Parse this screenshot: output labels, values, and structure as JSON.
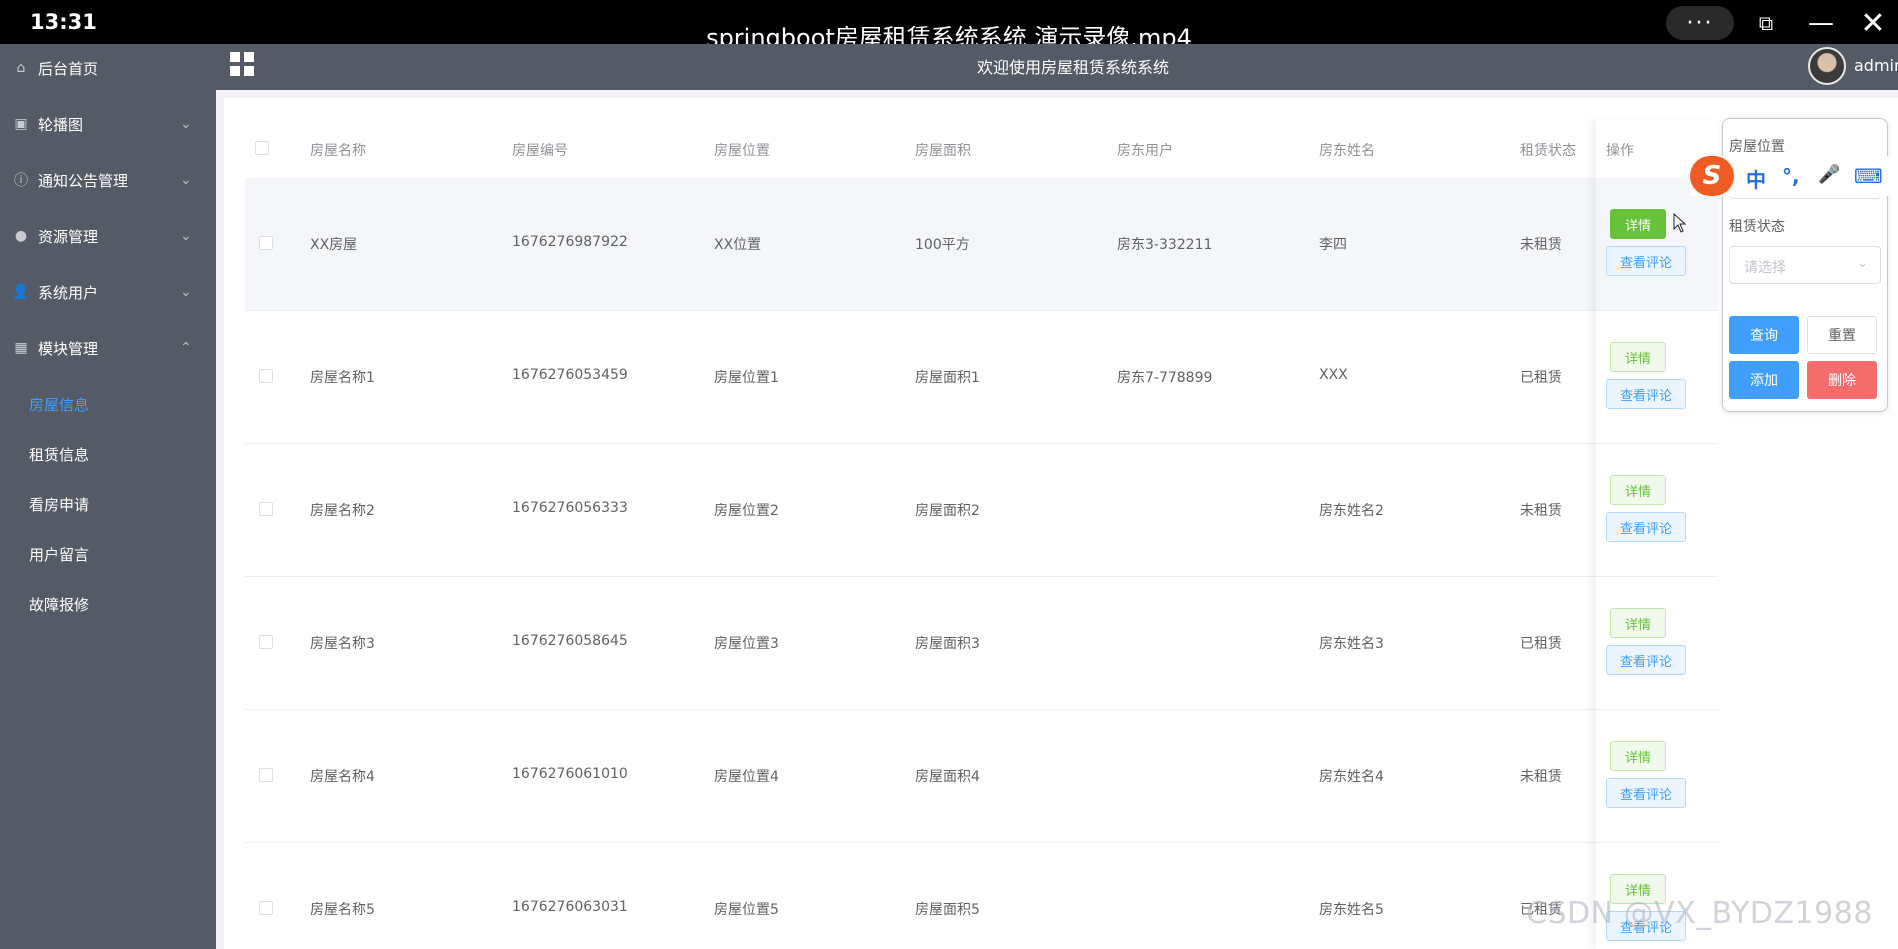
{
  "player": {
    "time": "13:31",
    "title": "springboot房屋租赁系统系统 演示录像.mp4",
    "more_label": "···",
    "pip_label": "⧉",
    "min_label": "—",
    "close_label": "✕"
  },
  "sidebar": {
    "items": [
      {
        "label": "后台首页",
        "icon": "home-icon"
      },
      {
        "label": "轮播图",
        "icon": "image-icon"
      },
      {
        "label": "通知公告管理",
        "icon": "info-icon"
      },
      {
        "label": "资源管理",
        "icon": "location-icon"
      },
      {
        "label": "系统用户",
        "icon": "user-icon"
      },
      {
        "label": "模块管理",
        "icon": "grid-icon"
      }
    ],
    "sub_items": [
      {
        "label": "房屋信息",
        "active": true
      },
      {
        "label": "租赁信息"
      },
      {
        "label": "看房申请"
      },
      {
        "label": "用户留言"
      },
      {
        "label": "故障报修"
      }
    ]
  },
  "header": {
    "welcome": "欢迎使用房屋租赁系统系统",
    "user": "admin"
  },
  "table": {
    "columns": [
      "房屋名称",
      "房屋编号",
      "房屋位置",
      "房屋面积",
      "房东用户",
      "房东姓名",
      "租赁状态",
      "操作"
    ],
    "rows": [
      [
        "XX房屋",
        "1676276987922",
        "XX位置",
        "100平方",
        "房东3-332211",
        "李四",
        "未租赁"
      ],
      [
        "房屋名称1",
        "1676276053459",
        "房屋位置1",
        "房屋面积1",
        "房东7-778899",
        "XXX",
        "已租赁"
      ],
      [
        "房屋名称2",
        "1676276056333",
        "房屋位置2",
        "房屋面积2",
        "",
        "房东姓名2",
        "未租赁"
      ],
      [
        "房屋名称3",
        "1676276058645",
        "房屋位置3",
        "房屋面积3",
        "",
        "房东姓名3",
        "已租赁"
      ],
      [
        "房屋名称4",
        "1676276061010",
        "房屋位置4",
        "房屋面积4",
        "",
        "房东姓名4",
        "未租赁"
      ],
      [
        "房屋名称5",
        "1676276063031",
        "房屋位置5",
        "房屋面积5",
        "",
        "房东姓名5",
        "已租赁"
      ]
    ],
    "detail_label": "详情",
    "review_label": "查看评论"
  },
  "search": {
    "location_label": "房屋位置",
    "status_label": "租赁状态",
    "status_placeholder": "请选择",
    "query_label": "查询",
    "reset_label": "重置",
    "add_label": "添加",
    "delete_label": "删除"
  },
  "ime": {
    "logo": "S",
    "items": [
      "中",
      "°,",
      "🎤",
      "⌨"
    ]
  },
  "watermark": "CSDN @VX_BYDZ1988",
  "colors": {
    "sidebar_bg": "#545b66",
    "active": "#409eff",
    "success": "#67c23a",
    "danger": "#f56c6c"
  }
}
